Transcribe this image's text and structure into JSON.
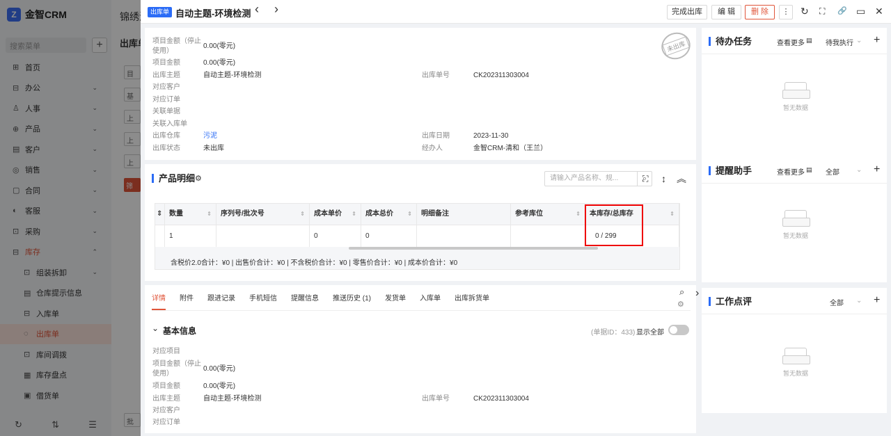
{
  "app": {
    "logo": "金智CRM",
    "logo_mark": "Z",
    "bg_title": "锦绣河",
    "bg_subtitle": "出库单"
  },
  "sidebar": {
    "search_placeholder": "搜索菜单",
    "plus": "+",
    "items": [
      {
        "icon": "⊞",
        "label": "首页",
        "chev": ""
      },
      {
        "icon": "⊟",
        "label": "办公",
        "chev": "⌄"
      },
      {
        "icon": "♙",
        "label": "人事",
        "chev": "⌄"
      },
      {
        "icon": "⊕",
        "label": "产品",
        "chev": "⌄"
      },
      {
        "icon": "▤",
        "label": "客户",
        "chev": "⌄"
      },
      {
        "icon": "◎",
        "label": "销售",
        "chev": "⌄"
      },
      {
        "icon": "▢",
        "label": "合同",
        "chev": "⌄"
      },
      {
        "icon": "◐",
        "label": "客服",
        "chev": "⌄"
      },
      {
        "icon": "⊡",
        "label": "采购",
        "chev": "⌄"
      },
      {
        "icon": "⊟",
        "label": "库存",
        "chev": "⌃"
      },
      {
        "icon": "⊡",
        "label": "组装拆卸",
        "chev": "⌄"
      },
      {
        "icon": "▤",
        "label": "仓库提示信息",
        "chev": ""
      },
      {
        "icon": "⊟",
        "label": "入库单",
        "chev": ""
      },
      {
        "icon": "◌",
        "label": "出库单",
        "chev": ""
      },
      {
        "icon": "⊡",
        "label": "库间调拨",
        "chev": ""
      },
      {
        "icon": "▦",
        "label": "库存盘点",
        "chev": ""
      },
      {
        "icon": "▣",
        "label": "借货单",
        "chev": ""
      }
    ],
    "bottom": [
      "↻",
      "⇅",
      "☰"
    ]
  },
  "bg_buttons": [
    "目",
    "基",
    "上",
    "上",
    "上"
  ],
  "bg_red": "筛",
  "bg_bottom_btn": "批",
  "header": {
    "badge": "出库单",
    "title": "自动主题-环境检测",
    "loading": "◌",
    "prev": "‹",
    "next": "›",
    "complete": "完成出库",
    "edit": "编 辑",
    "delete": "删 除",
    "more": "⋮",
    "refresh": "↻",
    "expand": "⛶",
    "link": "🔗",
    "screen": "▭",
    "close": "✕"
  },
  "stamp": "未出库",
  "info_top": {
    "amount_stopped_l1": "项目金额（停止",
    "amount_stopped_l2": "使用）",
    "amount_stopped_value": "0.00(零元)",
    "amount_label": "项目金额",
    "amount_value": "0.00(零元)",
    "subject_label": "出库主题",
    "subject_value": "自动主题-环境检测",
    "number_label": "出库单号",
    "number_value": "CK202311303004",
    "customer_label": "对应客户",
    "order_label": "对应订单",
    "related_label": "关联单据",
    "inbound_label": "关联入库单",
    "warehouse_label": "出库仓库",
    "warehouse_value": "污泥",
    "date_label": "出库日期",
    "date_value": "2023-11-30",
    "status_label": "出库状态",
    "status_value": "未出库",
    "handler_label": "经办人",
    "handler_value": "金智CRM-清和（王兰）"
  },
  "products": {
    "title": "产品明细",
    "gear": "⚙",
    "search_placeholder": "请输入产品名称、规...",
    "search_icon": "⌕",
    "fullscreen": "⛶",
    "height": "↕",
    "collapse": "︽",
    "columns": [
      "数量",
      "序列号/批次号",
      "成本单价",
      "成本总价",
      "明细备注",
      "参考库位",
      "本库存/总库存"
    ],
    "row": [
      "1",
      "",
      "0",
      "0",
      "",
      "",
      "0 / 299"
    ],
    "sort": "⇕",
    "summary": "含税价2.0合计：¥0 |  出售价合计：¥0 |  不含税价合计：¥0 |  零售价合计：¥0 |  成本价合计：¥0"
  },
  "tabs": [
    "详情",
    "附件",
    "跟进记录",
    "手机短信",
    "提醒信息",
    "推送历史 (1)",
    "发货单",
    "入库单",
    "出库拆货单"
  ],
  "tab_tools": {
    "search": "⌕",
    "gear": "⚙",
    "arrow": "›"
  },
  "basic": {
    "title": "基本信息",
    "chev": "⌄",
    "id_text": "(单据ID：433)",
    "show_all": "显示全部",
    "project_label": "对应项目",
    "amount_stopped_l1": "项目金额（停止",
    "amount_stopped_l2": "使用）",
    "amount_stopped_value": "0.00(零元)",
    "amount_label": "项目金额",
    "amount_value": "0.00(零元)",
    "subject_label": "出库主题",
    "subject_value": "自动主题-环境检测",
    "number_label": "出库单号",
    "number_value": "CK202311303004",
    "customer_label": "对应客户",
    "order_label": "对应订单"
  },
  "right": {
    "tasks": {
      "title": "待办任务",
      "more": "查看更多",
      "more_icon": "▤",
      "filter": "待我执行",
      "chev": "⌄",
      "add": "+",
      "empty": "暂无数据"
    },
    "reminder": {
      "title": "提醒助手",
      "more": "查看更多",
      "more_icon": "▤",
      "filter": "全部",
      "chev": "⌄",
      "add": "+",
      "empty": "暂无数据"
    },
    "review": {
      "title": "工作点评",
      "filter": "全部",
      "chev": "⌄",
      "add": "+",
      "empty": "暂无数据"
    }
  }
}
